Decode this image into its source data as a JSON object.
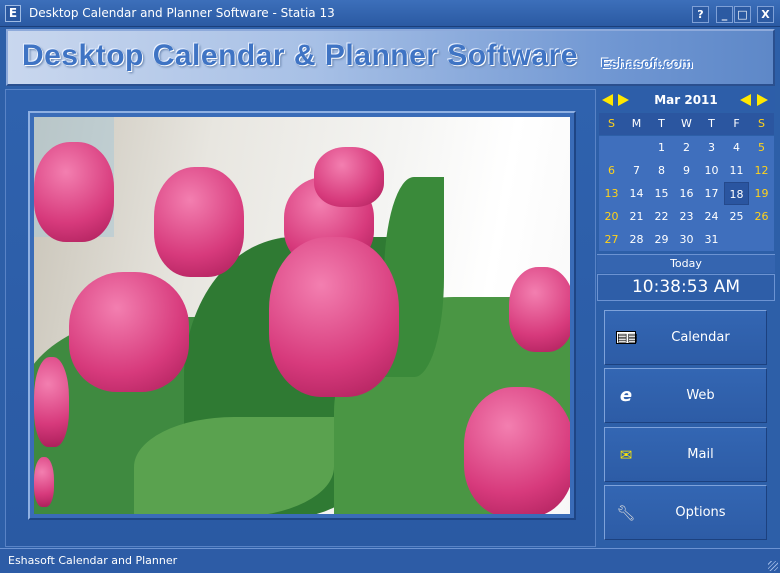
{
  "window": {
    "title": "Desktop Calendar and Planner Software - Statia 13",
    "help": "?",
    "minimize": "_",
    "maximize": "□",
    "close": "X",
    "app_icon": "E"
  },
  "banner": {
    "title": "Desktop Calendar & Planner Software",
    "site": "Eshasoft.com"
  },
  "calendar": {
    "month_label": "Mar 2011",
    "weekdays": [
      "S",
      "M",
      "T",
      "W",
      "T",
      "F",
      "S"
    ],
    "days": [
      "",
      "",
      "1",
      "2",
      "3",
      "4",
      "5",
      "6",
      "7",
      "8",
      "9",
      "10",
      "11",
      "12",
      "13",
      "14",
      "15",
      "16",
      "17",
      "18",
      "19",
      "20",
      "21",
      "22",
      "23",
      "24",
      "25",
      "26",
      "27",
      "28",
      "29",
      "30",
      "31",
      "",
      ""
    ],
    "selected_day": "18",
    "today_label": "Today",
    "time": "10:38:53 AM"
  },
  "nav": [
    {
      "label": "Calendar",
      "icon": "calendar-book-icon"
    },
    {
      "label": "Web",
      "icon": "internet-explorer-icon"
    },
    {
      "label": "Mail",
      "icon": "mail-icon"
    },
    {
      "label": "Options",
      "icon": "wrench-icon"
    }
  ],
  "status": {
    "text": "Eshasoft Calendar and Planner"
  }
}
